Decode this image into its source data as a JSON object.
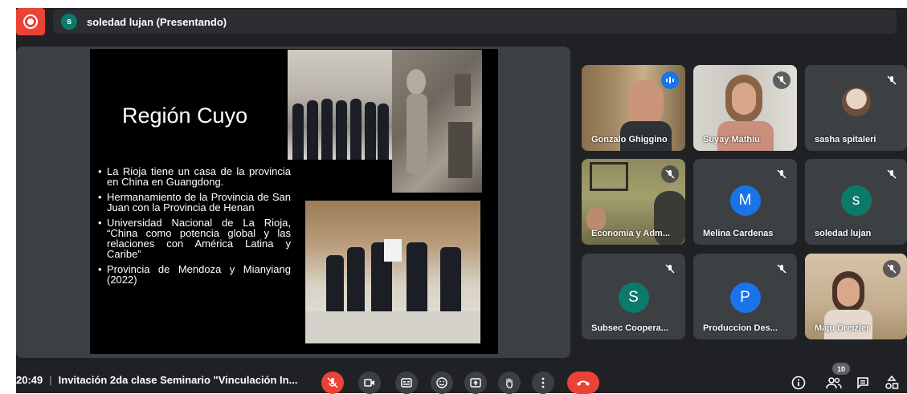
{
  "presenter": {
    "avatar_letter": "s",
    "label": "soledad lujan (Presentando)"
  },
  "slide": {
    "title": "Región Cuyo",
    "bullets": [
      "La Rioja tiene un casa de la provincia en China en Guangdong.",
      "Hermanamiento de la Provincia de San Juan con la Provincia de Henan",
      "Universidad Nacional de La Rioja, “China como potencia global y las relaciones con América Latina y Caribe”",
      "Provincia de Mendoza y Mianyiang (2022)"
    ]
  },
  "participants": [
    {
      "name": "Gonzalo Ghiggino",
      "state": "speaking",
      "video": true
    },
    {
      "name": "Suyay Mathiu",
      "state": "muted",
      "video": true
    },
    {
      "name": "sasha spitaleri",
      "state": "muted",
      "video": false,
      "photo": true
    },
    {
      "name": "Economia y Adm...",
      "state": "muted",
      "video": true
    },
    {
      "name": "Melina Cardenas",
      "state": "muted",
      "avatar_letter": "M",
      "avatar_color": "#1a73e8"
    },
    {
      "name": "soledad lujan",
      "state": "muted",
      "avatar_letter": "s",
      "avatar_color": "#0b7a6a"
    },
    {
      "name": "Subsec Coopera...",
      "state": "muted",
      "avatar_letter": "S",
      "avatar_color": "#0b7a6a"
    },
    {
      "name": "Produccion Des...",
      "state": "muted",
      "avatar_letter": "P",
      "avatar_color": "#1a73e8"
    },
    {
      "name": "Maju Dreizler",
      "state": "muted",
      "video": true
    }
  ],
  "bottom": {
    "time": "20:49",
    "separator": "|",
    "meeting_title": "Invitación 2da clase Seminario \"Vinculación In...",
    "participant_count": "10"
  },
  "colors": {
    "background": "#202124",
    "tile": "#3c4043",
    "red": "#ea4335",
    "accent": "#1a73e8"
  },
  "icons": [
    "record-icon",
    "mic-off-icon",
    "camera-icon",
    "captions-icon",
    "emoji-icon",
    "present-icon",
    "raise-hand-icon",
    "more-icon",
    "end-call-icon",
    "info-icon",
    "people-icon",
    "chat-icon",
    "activities-icon"
  ]
}
